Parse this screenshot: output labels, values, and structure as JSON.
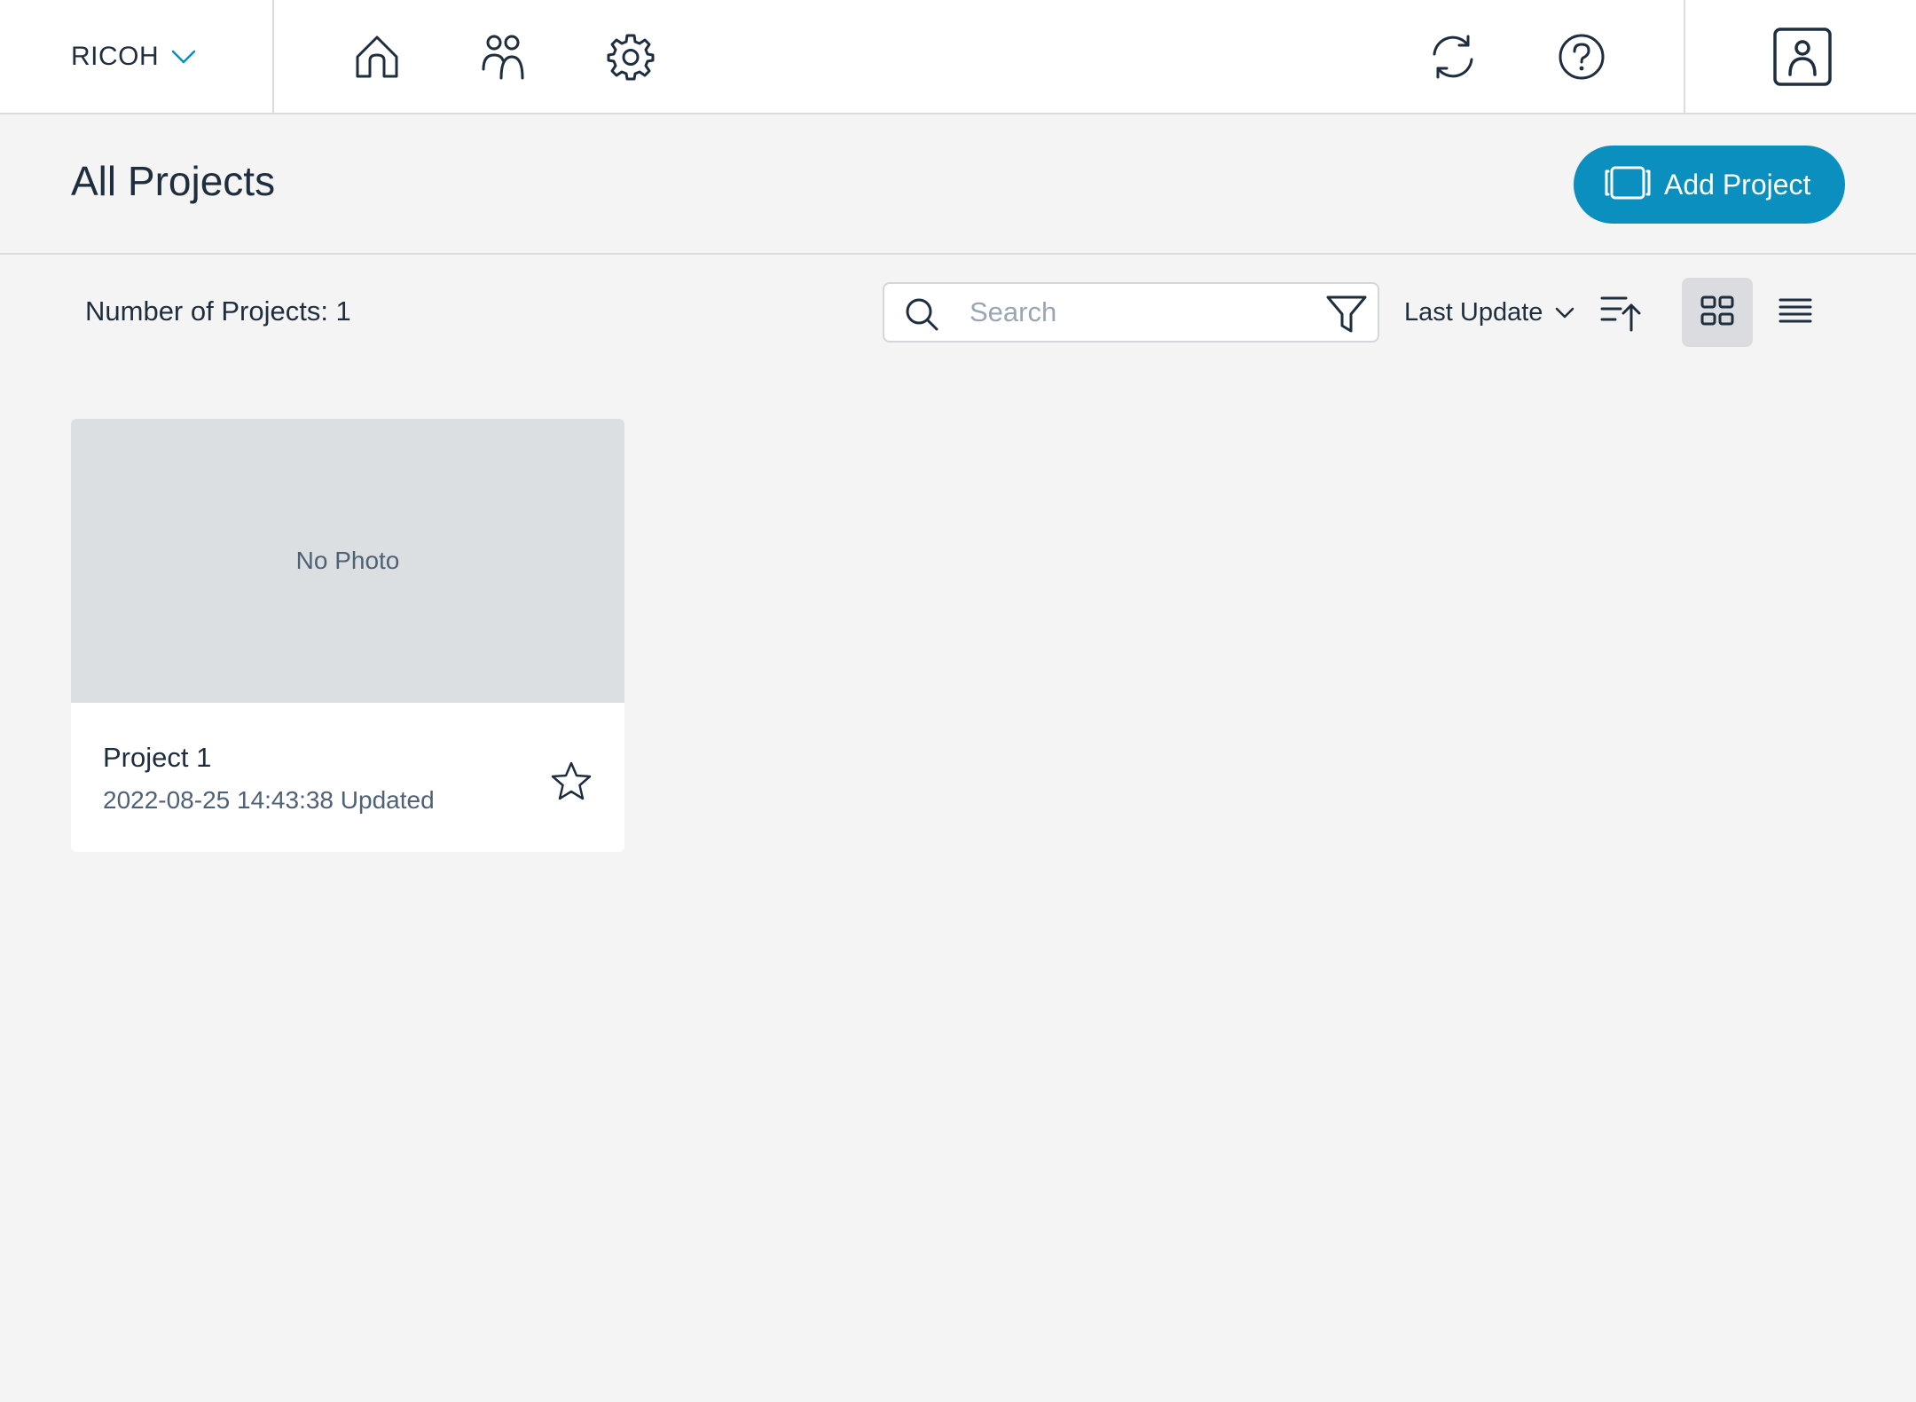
{
  "topbar": {
    "org_name": "RICOH",
    "icons": {
      "home": "home-icon",
      "users": "users-icon",
      "settings": "gear-icon",
      "sync": "sync-icon",
      "help": "help-icon",
      "account": "account-icon"
    }
  },
  "header": {
    "title": "All Projects",
    "add_button_label": "Add Project"
  },
  "toolbar": {
    "count_label": "Number of Projects: 1",
    "search_placeholder": "Search",
    "search_value": "",
    "sort_selected": "Last Update",
    "view_mode": "grid"
  },
  "projects": [
    {
      "photo_text": "No Photo",
      "name": "Project 1",
      "updated": "2022-08-25 14:43:38 Updated",
      "starred": false
    }
  ],
  "colors": {
    "accent": "#0a8fbf",
    "text": "#1e2e3e",
    "muted_text": "#4f6275",
    "background": "#f4f4f4"
  }
}
